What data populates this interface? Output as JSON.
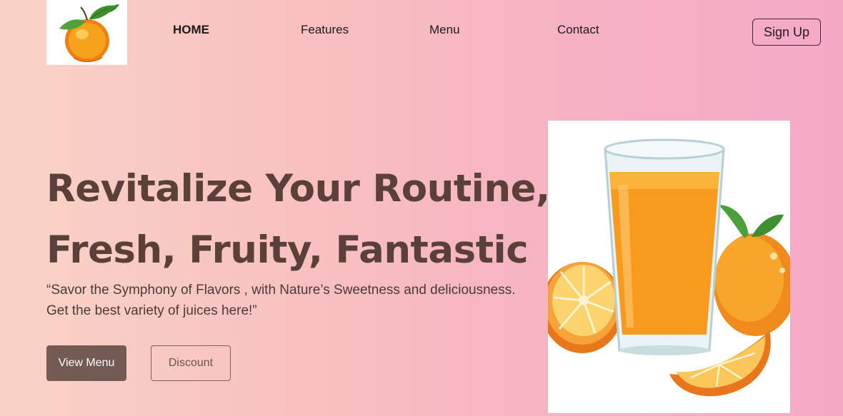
{
  "header": {
    "logo_icon": "orange-fruit-logo",
    "nav": [
      {
        "label": "HOME"
      },
      {
        "label": "Features"
      },
      {
        "label": "Menu"
      },
      {
        "label": "Contact"
      }
    ],
    "signup_label": "Sign Up"
  },
  "hero": {
    "title_line1": "Revitalize Your Routine,",
    "title_line2": "Fresh, Fruity, Fantastic",
    "subtitle_line1": "“Savor the Symphony of Flavors , with Nature’s Sweetness and deliciousness.",
    "subtitle_line2": "Get the best variety of juices here!”",
    "primary_button": "View Menu",
    "secondary_button": "Discount",
    "image_icon": "orange-juice-glass-illustration"
  },
  "colors": {
    "title": "#5a4038",
    "primary_button_bg": "#735a52",
    "orange": "#f7941d"
  }
}
